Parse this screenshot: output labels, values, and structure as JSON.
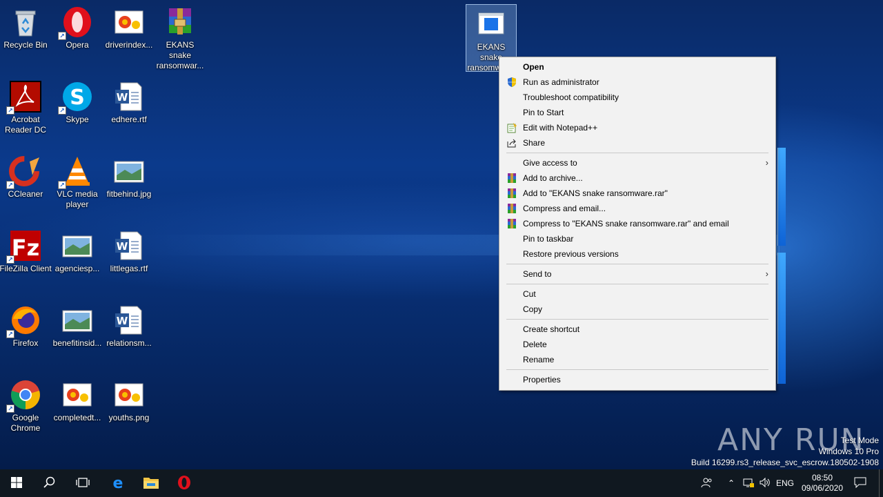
{
  "desktop": {
    "icons": [
      {
        "label": "Recycle Bin",
        "icon": "recycle-bin-icon"
      },
      {
        "label": "Opera",
        "icon": "opera-icon"
      },
      {
        "label": "driverindex...",
        "icon": "image-file-icon"
      },
      {
        "label": "EKANS snake ransomwar...",
        "icon": "winrar-icon"
      },
      {
        "label": "Acrobat Reader DC",
        "icon": "acrobat-icon"
      },
      {
        "label": "Skype",
        "icon": "skype-icon"
      },
      {
        "label": "edhere.rtf",
        "icon": "word-doc-icon"
      },
      {
        "label": "CCleaner",
        "icon": "ccleaner-icon"
      },
      {
        "label": "VLC media player",
        "icon": "vlc-icon"
      },
      {
        "label": "fitbehind.jpg",
        "icon": "landscape-image-icon"
      },
      {
        "label": "FileZilla Client",
        "icon": "filezilla-icon"
      },
      {
        "label": "agenciesp...",
        "icon": "landscape-image-icon"
      },
      {
        "label": "littlegas.rtf",
        "icon": "word-doc-icon"
      },
      {
        "label": "Firefox",
        "icon": "firefox-icon"
      },
      {
        "label": "benefitinsid...",
        "icon": "landscape-image-icon"
      },
      {
        "label": "relationsm...",
        "icon": "word-doc-icon"
      },
      {
        "label": "Google Chrome",
        "icon": "chrome-icon"
      },
      {
        "label": "completedt...",
        "icon": "image-file-icon"
      },
      {
        "label": "youths.png",
        "icon": "image-file-icon"
      }
    ],
    "selected_icon": {
      "label": "EKANS snake ransomware.exe",
      "icon": "exe-file-icon"
    }
  },
  "context_menu": {
    "items": [
      {
        "label": "Open",
        "bold": true
      },
      {
        "label": "Run as administrator",
        "icon": "uac-shield-icon"
      },
      {
        "label": "Troubleshoot compatibility"
      },
      {
        "label": "Pin to Start"
      },
      {
        "label": "Edit with Notepad++",
        "icon": "notepadpp-icon"
      },
      {
        "label": "Share",
        "icon": "share-icon"
      },
      {
        "separator": true
      },
      {
        "label": "Give access to",
        "submenu": true
      },
      {
        "label": "Add to archive...",
        "icon": "winrar-icon"
      },
      {
        "label": "Add to \"EKANS snake ransomware.rar\"",
        "icon": "winrar-icon"
      },
      {
        "label": "Compress and email...",
        "icon": "winrar-icon"
      },
      {
        "label": "Compress to \"EKANS snake ransomware.rar\" and email",
        "icon": "winrar-icon"
      },
      {
        "label": "Pin to taskbar"
      },
      {
        "label": "Restore previous versions"
      },
      {
        "separator": true
      },
      {
        "label": "Send to",
        "submenu": true
      },
      {
        "separator": true
      },
      {
        "label": "Cut"
      },
      {
        "label": "Copy"
      },
      {
        "separator": true
      },
      {
        "label": "Create shortcut"
      },
      {
        "label": "Delete"
      },
      {
        "label": "Rename"
      },
      {
        "separator": true
      },
      {
        "label": "Properties"
      }
    ]
  },
  "watermark": {
    "line1": "Test Mode",
    "line2": "Windows 10 Pro",
    "line3": "Build 16299.rs3_release_svc_escrow.180502-1908",
    "brand": "ANY RUN"
  },
  "taskbar": {
    "apps": [
      "start-icon",
      "search-icon",
      "task-view-icon",
      "edge-icon",
      "file-explorer-icon",
      "opera-icon"
    ],
    "tray": {
      "language": "ENG",
      "time": "08:50",
      "date": "09/06/2020"
    }
  },
  "colors": {
    "taskbar": "#101820",
    "menu_bg": "#f2f2f2",
    "desktop_accent": "#0b3a8c"
  }
}
